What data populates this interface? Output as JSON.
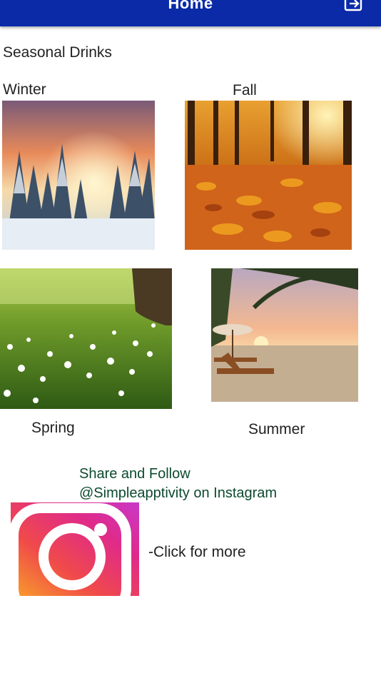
{
  "header": {
    "title": "Home",
    "icon": "exit-icon",
    "color": "#0a2aa8"
  },
  "section_title": "Seasonal Drinks",
  "seasons": [
    {
      "label": "Winter"
    },
    {
      "label": "Fall"
    },
    {
      "label": "Spring"
    },
    {
      "label": "Summer"
    }
  ],
  "share": {
    "line1": "Share and Follow",
    "line2": "@Simpleapptivity on Instagram"
  },
  "instagram": {
    "icon": "instagram-icon",
    "cta": "-Click for more"
  }
}
